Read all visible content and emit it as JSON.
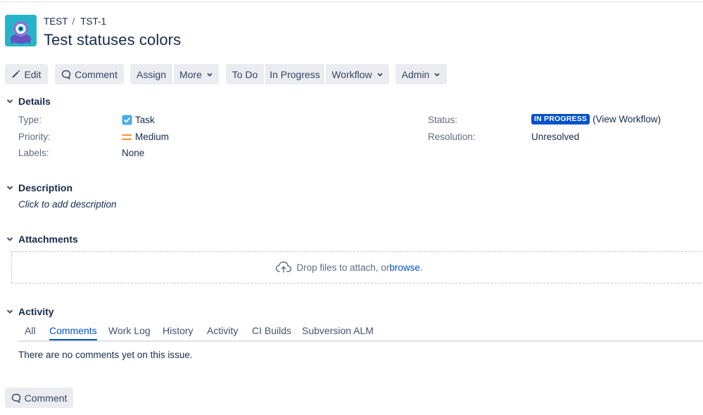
{
  "breadcrumb": {
    "project": "TEST",
    "separator": "/",
    "issue_key": "TST-1"
  },
  "issue": {
    "title": "Test statuses colors"
  },
  "toolbar": {
    "edit": "Edit",
    "comment": "Comment",
    "assign": "Assign",
    "more": "More",
    "todo": "To Do",
    "in_progress": "In Progress",
    "workflow": "Workflow",
    "admin": "Admin"
  },
  "details": {
    "heading": "Details",
    "type_label": "Type:",
    "type_value": "Task",
    "priority_label": "Priority:",
    "priority_value": "Medium",
    "labels_label": "Labels:",
    "labels_value": "None",
    "status_label": "Status:",
    "status_value": "IN PROGRESS",
    "view_workflow": "(View Workflow)",
    "resolution_label": "Resolution:",
    "resolution_value": "Unresolved"
  },
  "description": {
    "heading": "Description",
    "placeholder": "Click to add description"
  },
  "attachments": {
    "heading": "Attachments",
    "drop_text": "Drop files to attach, or ",
    "browse": "browse."
  },
  "activity": {
    "heading": "Activity",
    "tabs": [
      "All",
      "Comments",
      "Work Log",
      "History",
      "Activity",
      "CI Builds",
      "Subversion ALM"
    ],
    "active_tab": "Comments",
    "empty": "There are no comments yet on this issue."
  },
  "footer": {
    "comment": "Comment"
  },
  "colors": {
    "accent": "#0052cc",
    "button_bg": "#ebecf0",
    "priority_medium": "#f79232",
    "task_icon": "#4bade8",
    "avatar_bg": "#26b5c8"
  }
}
